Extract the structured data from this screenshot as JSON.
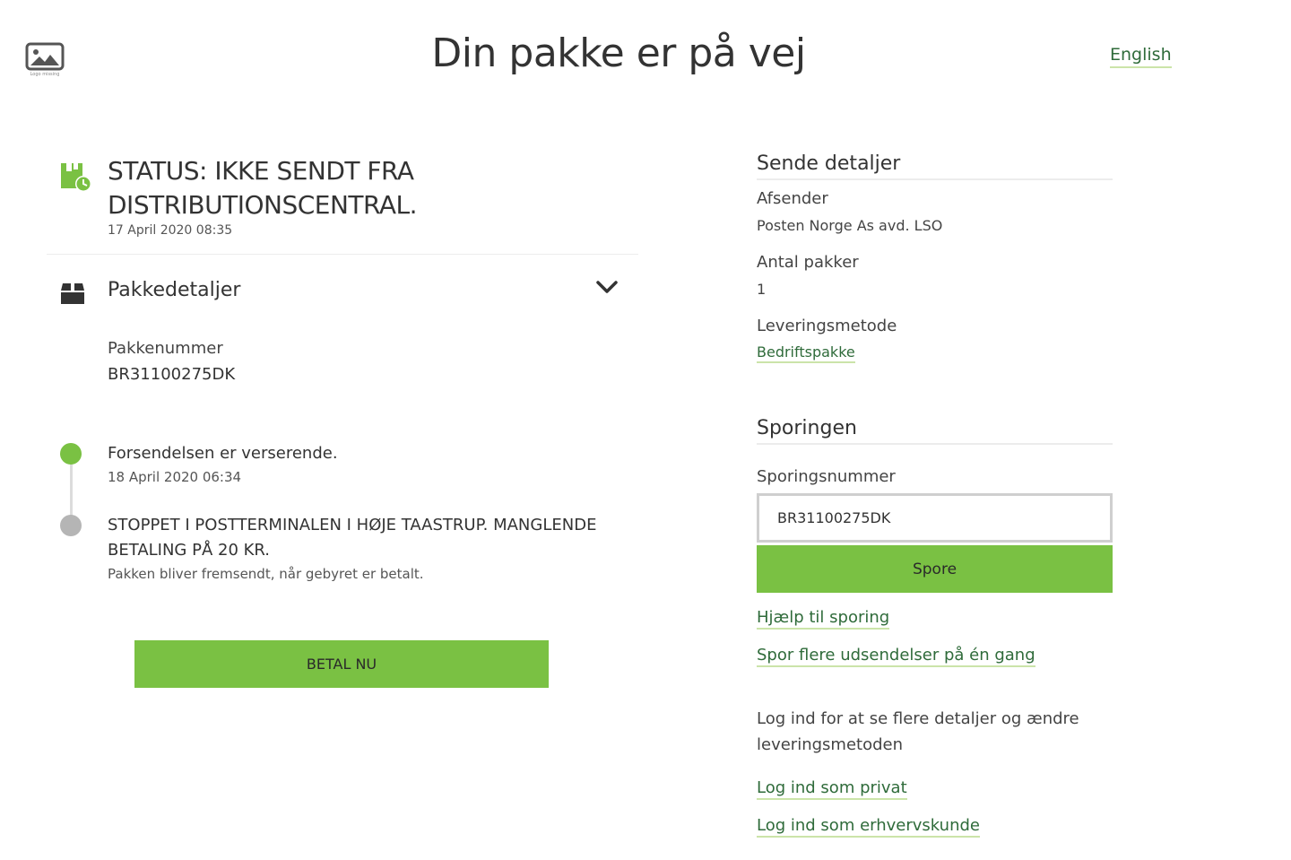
{
  "header": {
    "logo_caption": "Logo missing",
    "title": "Din pakke er på vej",
    "language_link": "English"
  },
  "status": {
    "title": "STATUS: IKKE SENDT FRA DISTRIBUTIONSCENTRAL.",
    "date": "17 April 2020 08:35"
  },
  "package_details": {
    "title": "Pakkedetaljer",
    "number_label": "Pakkenummer",
    "number_value": "BR31100275DK"
  },
  "timeline": [
    {
      "title": "Forsendelsen er verserende.",
      "date": "18 April 2020 06:34",
      "color": "#7ac143"
    },
    {
      "title": "STOPPET I POSTTERMINALEN I HØJE TAASTRUP. MANGLENDE BETALING PÅ 20 KR.",
      "description": "Pakken bliver fremsendt, når gebyret er betalt.",
      "color": "#b5b5b5"
    }
  ],
  "pay_button": "BETAL NU",
  "send_details": {
    "title": "Sende detaljer",
    "sender_label": "Afsender",
    "sender_value": "Posten Norge As avd. LSO",
    "count_label": "Antal pakker",
    "count_value": "1",
    "method_label": "Leveringsmetode",
    "method_value": "Bedriftspakke"
  },
  "tracking": {
    "title": "Sporingen",
    "number_label": "Sporingsnummer",
    "number_value": "BR31100275DK",
    "button": "Spore",
    "help_link": "Hjælp til sporing",
    "multi_link": "Spor flere udsendelser på én gang"
  },
  "login": {
    "text": "Log ind for at se flere detaljer og ændre leveringsmetoden",
    "private_link": "Log ind som privat",
    "business_link": "Log ind som erhvervskunde"
  },
  "colors": {
    "accent": "#7ac143",
    "link": "#2f6b3a",
    "link_underline": "#cbe4a9"
  }
}
